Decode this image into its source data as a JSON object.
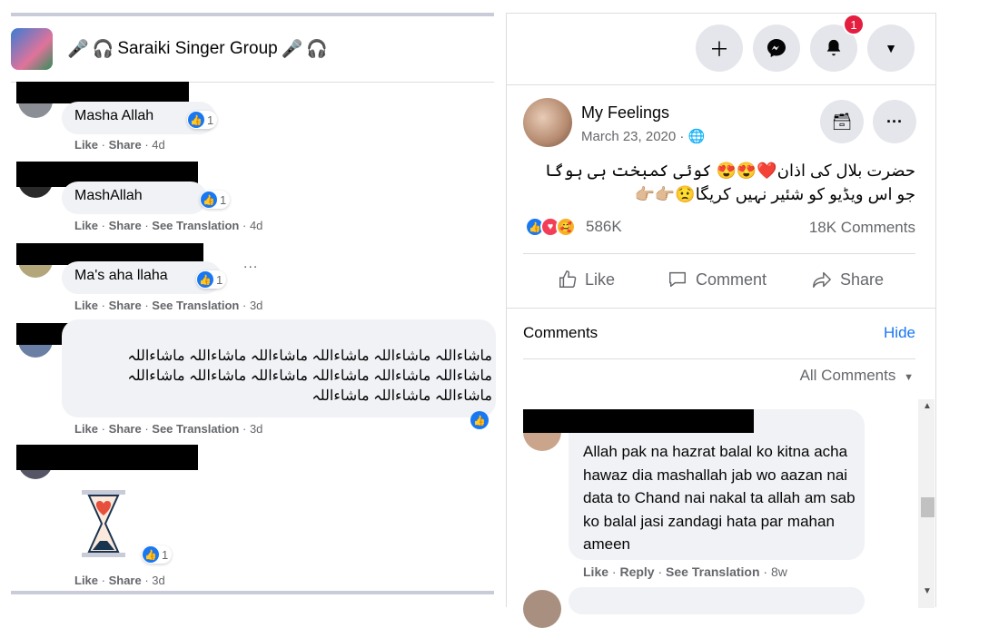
{
  "group": {
    "name": "Saraiki Singer Group",
    "icons": [
      "microphone-icon",
      "headphones-icon"
    ]
  },
  "left_comments": [
    {
      "text": "Masha Allah",
      "reactions": "1",
      "actions": [
        "Like",
        "Share"
      ],
      "time": "4d"
    },
    {
      "text": "MashAllah",
      "reactions": "1",
      "actions": [
        "Like",
        "Share",
        "See Translation"
      ],
      "time": "4d"
    },
    {
      "text": "Ma's aha llaha",
      "reactions": "1",
      "actions": [
        "Like",
        "Share",
        "See Translation"
      ],
      "time": "3d",
      "more": "..."
    },
    {
      "text_lines": [
        "ماشاءاللہ ماشاءاللہ ماشاءاللہ ماشاءاللہ ماشاءاللہ ماشاءاللہ",
        "ماشاءاللہ ماشاءاللہ ماشاءاللہ ماشاءاللہ ماشاءاللہ ماشاءاللہ",
        "ماشاءاللہ ماشاءاللہ ماشاءاللہ"
      ],
      "actions": [
        "Like",
        "Share",
        "See Translation"
      ],
      "time": "3d"
    },
    {
      "sticker": "hourglass-heart",
      "reactions": "1",
      "actions": [
        "Like",
        "Share"
      ],
      "time": "3d"
    }
  ],
  "topbar": {
    "notification_count": "1"
  },
  "post": {
    "author": "My Feelings",
    "date": "March 23, 2020 · ",
    "text_lines": [
      "حضرت بلال کی اذان❤️😍😍 کوئی کمبخت ہی ہوگا",
      "جو اس ویڈیو کو شئیر نہیں کریگا😟👉🏼👉🏼"
    ],
    "reaction_count": "586K",
    "comments_count": "18K Comments",
    "actions": {
      "like": "Like",
      "comment": "Comment",
      "share": "Share"
    }
  },
  "comments_section": {
    "title": "Comments",
    "hide": "Hide",
    "filter": "All Comments",
    "comment": {
      "text": "Allah pak na hazrat balal ko kitna acha hawaz dia mashallah jab wo aazan nai data to Chand nai nakal ta allah am sab ko balal jasi zandagi hata par mahan ameen",
      "actions": [
        "Like",
        "Reply",
        "See Translation"
      ],
      "time": "8w"
    }
  },
  "colors": {
    "accent": "#1877f2",
    "badge": "#e41e3f",
    "bubble": "#f0f2f5"
  }
}
